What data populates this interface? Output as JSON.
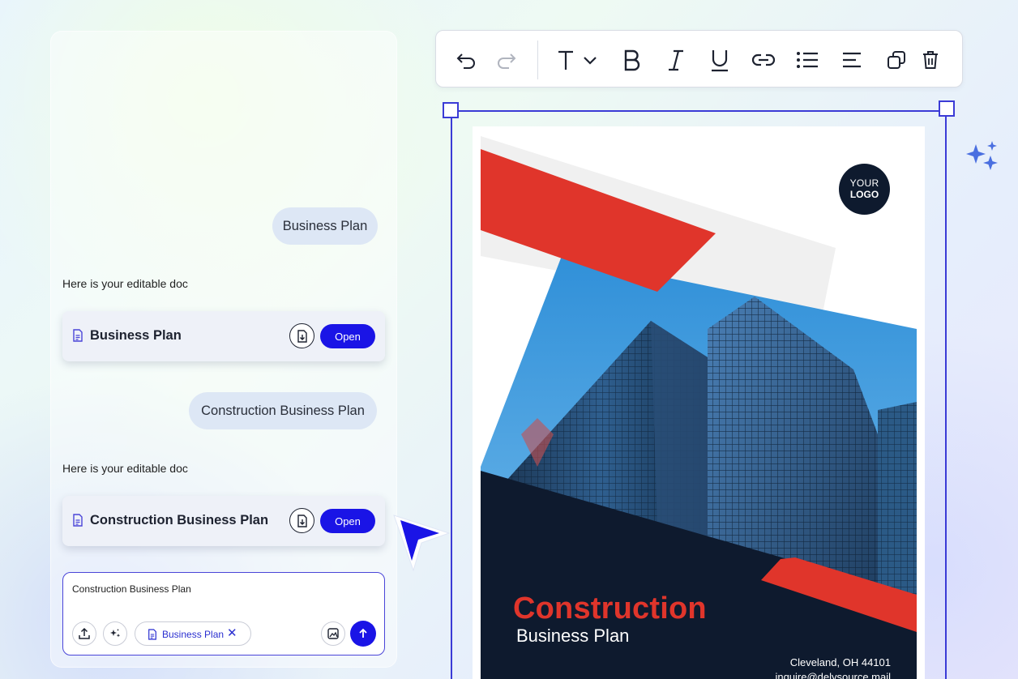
{
  "chat": {
    "messages": [
      {
        "user_bubble": "Business Plan",
        "reply": "Here is your editable doc",
        "doc_title": "Business Plan",
        "open_label": "Open"
      },
      {
        "user_bubble": "Construction Business Plan",
        "reply": "Here is your editable doc",
        "doc_title": "Construction Business Plan",
        "open_label": "Open"
      }
    ],
    "composer": {
      "text": "Construction Business Plan",
      "chip_label": "Business Plan",
      "chip_close": "✕"
    }
  },
  "toolbar": {
    "tools": [
      "undo-icon",
      "redo-icon",
      "text-style-icon",
      "bold-icon",
      "italic-icon",
      "underline-icon",
      "link-icon",
      "bullet-list-icon",
      "align-icon",
      "duplicate-icon",
      "delete-icon"
    ]
  },
  "document": {
    "logo_line1": "YOUR",
    "logo_line2": "LOGO",
    "title": "Construction",
    "subtitle": "Business Plan",
    "address": "Cleveland, OH 44101",
    "email": "inquire@delysource.mail"
  },
  "colors": {
    "accent": "#1a14e6",
    "selection": "#3b3bd6",
    "cover_red": "#e0352b",
    "cover_navy": "#0e1a2e"
  }
}
